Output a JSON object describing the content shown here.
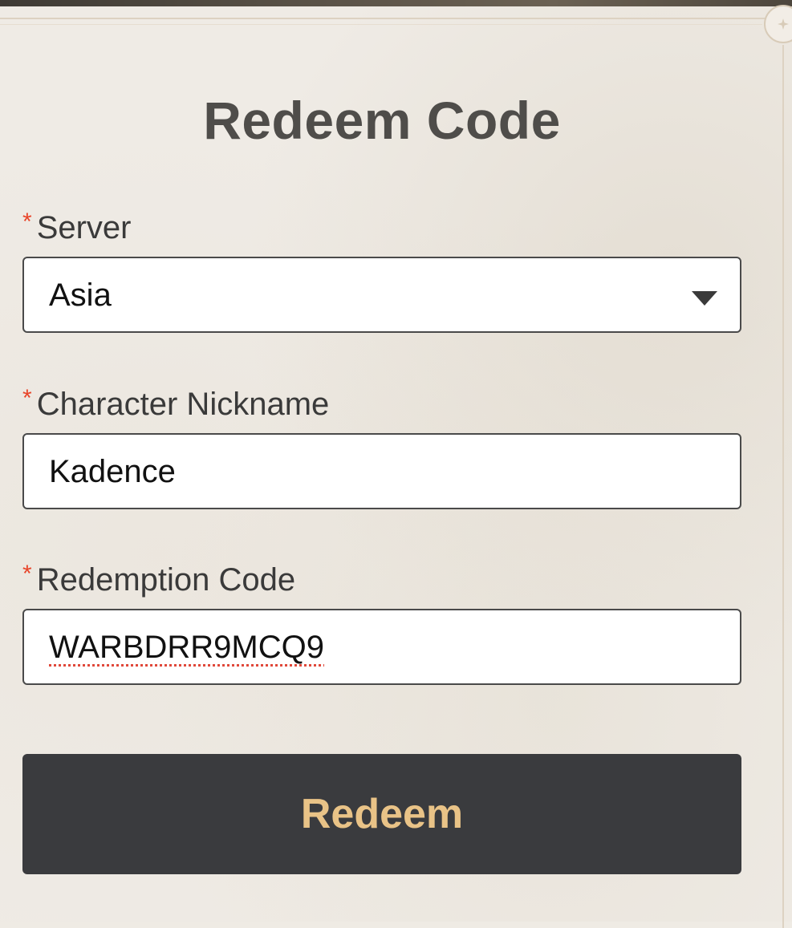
{
  "form": {
    "title": "Redeem Code",
    "required_marker": "*",
    "server": {
      "label": "Server",
      "selected_value": "Asia"
    },
    "nickname": {
      "label": "Character Nickname",
      "value": "Kadence"
    },
    "code": {
      "label": "Redemption Code",
      "value": "WARBDRR9MCQ9"
    },
    "submit_label": "Redeem"
  },
  "colors": {
    "background": "#efebe5",
    "title_text": "#4f4d4a",
    "required_star": "#e8452a",
    "button_bg": "#3a3b3e",
    "button_text": "#e9c387"
  },
  "icons": {
    "dropdown": "chevron-down-icon",
    "corner": "corner-ornament-icon"
  }
}
